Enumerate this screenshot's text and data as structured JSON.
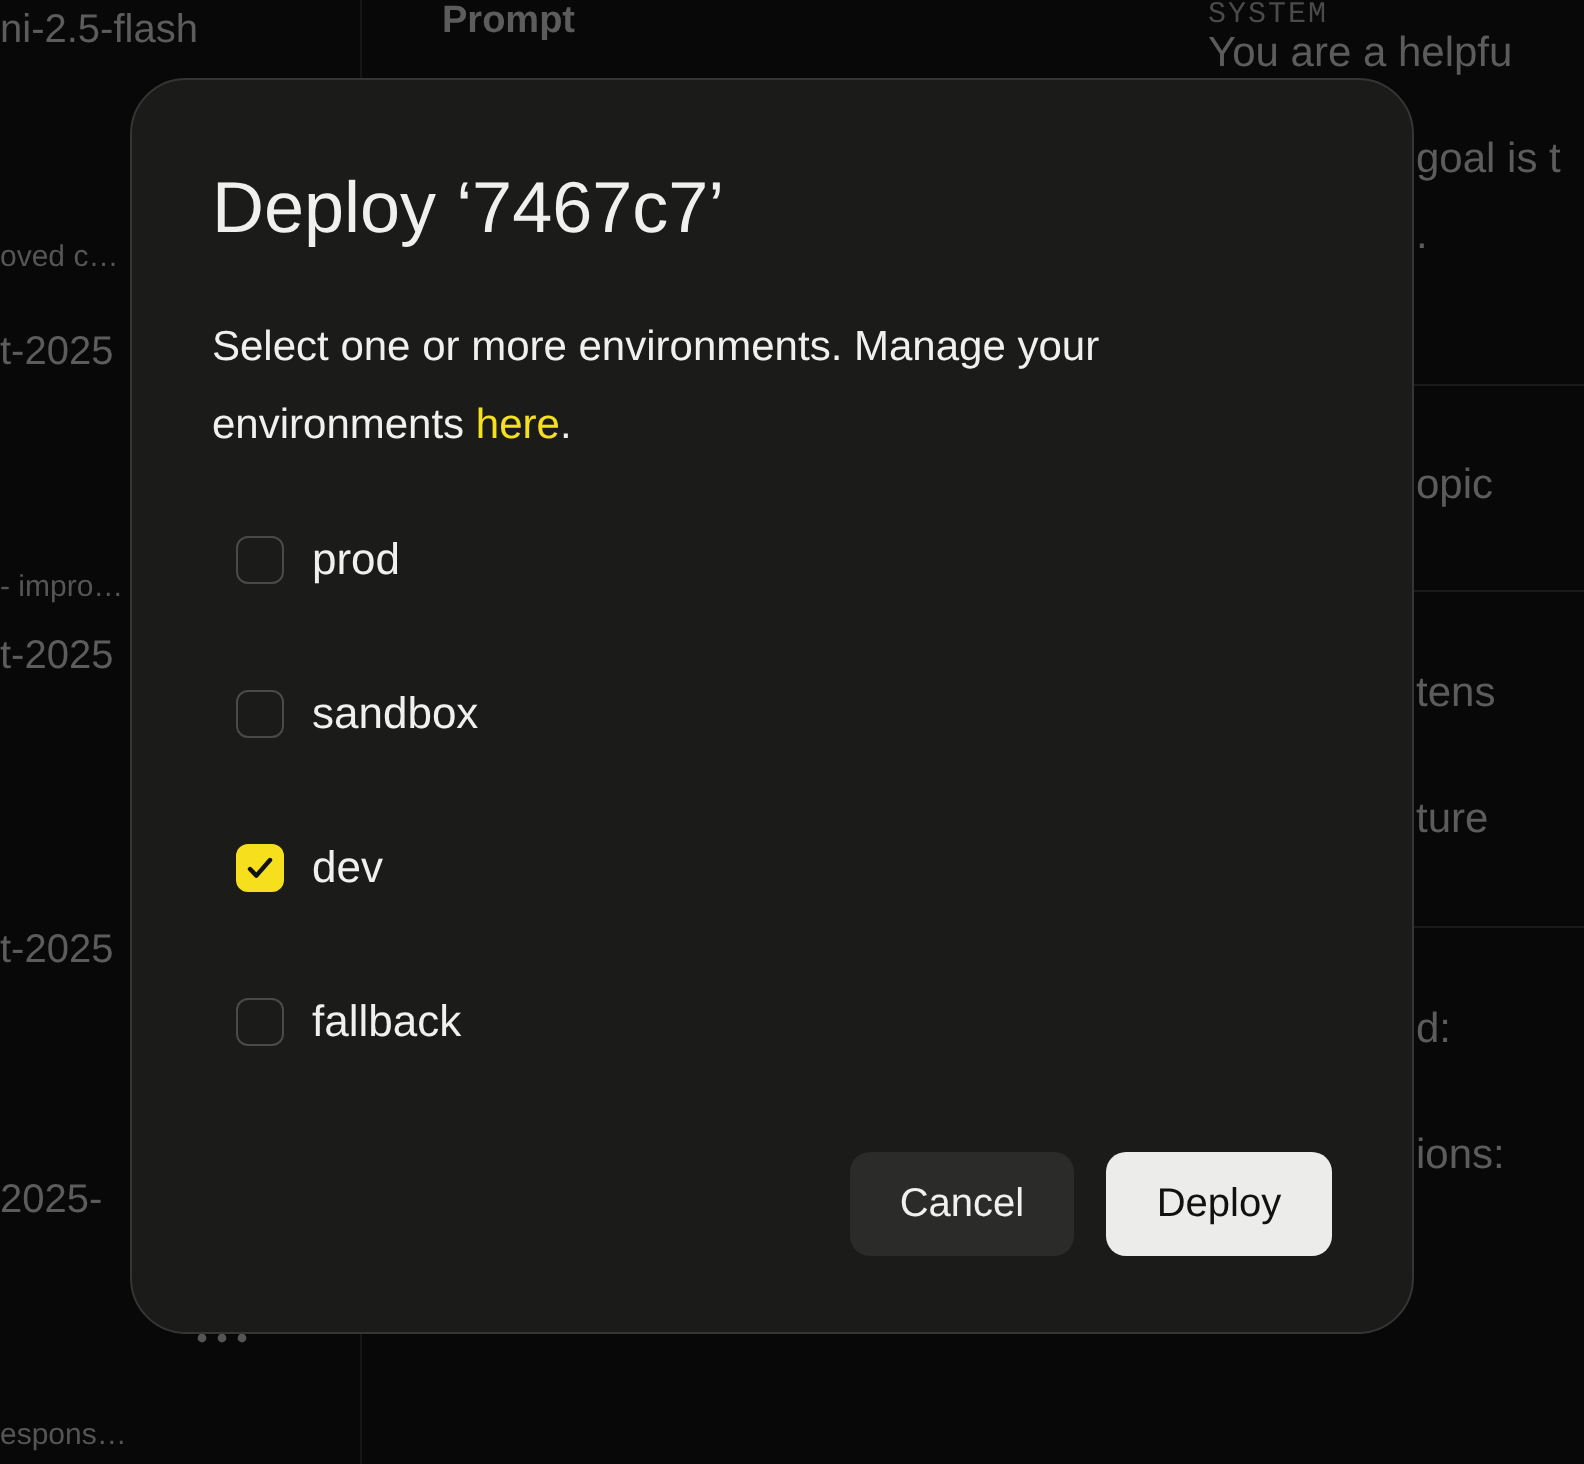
{
  "background": {
    "left_items": [
      {
        "kind": "title",
        "text": "ni-2.5-flash"
      },
      {
        "kind": "sub",
        "text": "oved c…"
      },
      {
        "kind": "title",
        "text": "t-2025"
      },
      {
        "kind": "sub",
        "text": "- impro…"
      },
      {
        "kind": "title",
        "text": "t-2025"
      },
      {
        "kind": "title",
        "text": "t-2025"
      },
      {
        "kind": "title",
        "text": "2025-"
      },
      {
        "kind": "sub",
        "text": "espons…"
      }
    ],
    "prompt_heading": "Prompt",
    "system_label": "SYSTEM",
    "system_text": "You are a helpfu",
    "right_items": [
      "goal is t",
      ".",
      "opic",
      "tens",
      "ture",
      "d:",
      "ions:"
    ]
  },
  "dialog": {
    "title": "Deploy ‘7467c7’",
    "description": {
      "before": "Select one or more environments. Manage your environments ",
      "link": "here",
      "after": "."
    },
    "environments": [
      {
        "name": "prod",
        "checked": false
      },
      {
        "name": "sandbox",
        "checked": false
      },
      {
        "name": "dev",
        "checked": true
      },
      {
        "name": "fallback",
        "checked": false
      }
    ],
    "buttons": [
      {
        "label": "Cancel",
        "kind": "secondary"
      },
      {
        "label": "Deploy",
        "kind": "primary"
      }
    ]
  }
}
